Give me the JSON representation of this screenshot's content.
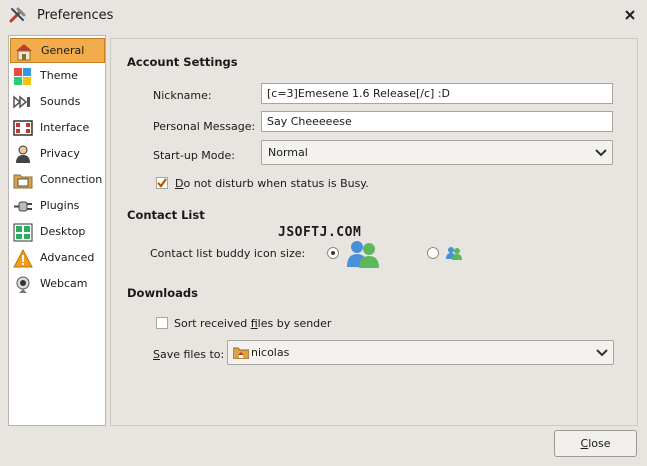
{
  "window": {
    "title": "Preferences"
  },
  "sidebar": {
    "items": [
      {
        "label": "General",
        "selected": true,
        "icon": "home-icon"
      },
      {
        "label": "Theme",
        "icon": "palette-icon"
      },
      {
        "label": "Sounds",
        "icon": "speaker-icon"
      },
      {
        "label": "Interface",
        "icon": "monitor-icon"
      },
      {
        "label": "Privacy",
        "icon": "person-icon"
      },
      {
        "label": "Connection",
        "icon": "folder-icon"
      },
      {
        "label": "Plugins",
        "icon": "plug-icon"
      },
      {
        "label": "Desktop",
        "icon": "desktop-icon"
      },
      {
        "label": "Advanced",
        "icon": "warning-icon"
      },
      {
        "label": "Webcam",
        "icon": "webcam-icon"
      }
    ]
  },
  "account": {
    "heading": "Account Settings",
    "nickname_label": "Nickname:",
    "nickname_value": "[c=3]Emesene 1.6 Release[/c] :D",
    "personal_message_label": "Personal Message:",
    "personal_message_value": "Say Cheeeeese",
    "startup_mode_label": "Start-up Mode:",
    "startup_mode_value": "Normal",
    "dnd_label_mnemonic": "D",
    "dnd_label_rest": "o not disturb when status is Busy.",
    "dnd_checked": true
  },
  "contact_list": {
    "heading": "Contact List",
    "icon_size_label": "Contact list buddy icon size:",
    "large_selected": true
  },
  "watermark": "JSOFTJ.COM",
  "downloads": {
    "heading": "Downloads",
    "sort_label_pre": "Sort received ",
    "sort_label_mnemonic": "f",
    "sort_label_post": "iles by sender",
    "sort_checked": false,
    "save_label_mnemonic": "S",
    "save_label_rest": "ave files to:",
    "save_folder": "nicolas"
  },
  "footer": {
    "close_mnemonic": "C",
    "close_rest": "lose"
  },
  "colors": {
    "selection": "#f3ac4b",
    "background": "#e8e5e0"
  }
}
